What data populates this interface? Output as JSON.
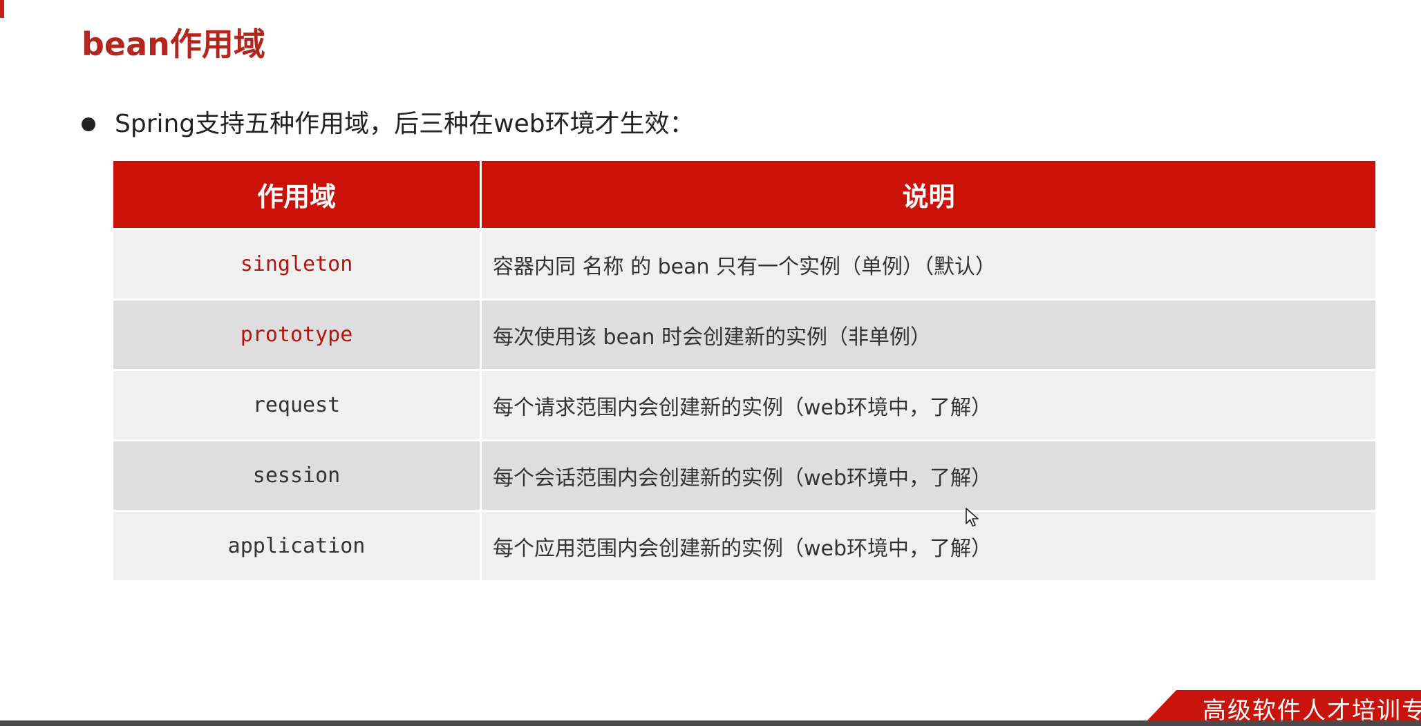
{
  "slide": {
    "title": "bean作用域",
    "bullet": "Spring支持五种作用域，后三种在web环境才生效：",
    "colors": {
      "accent": "#cc1208",
      "title": "#b3261e",
      "highlight_text": "#b3150c"
    }
  },
  "table": {
    "headers": {
      "scope": "作用域",
      "description": "说明"
    },
    "rows": [
      {
        "scope": "singleton",
        "description": "容器内同 名称 的 bean 只有一个实例（单例）（默认）",
        "highlight": true
      },
      {
        "scope": "prototype",
        "description": "每次使用该 bean 时会创建新的实例（非单例）",
        "highlight": true
      },
      {
        "scope": "request",
        "description": "每个请求范围内会创建新的实例（web环境中，了解）",
        "highlight": false
      },
      {
        "scope": "session",
        "description": "每个会话范围内会创建新的实例（web环境中，了解）",
        "highlight": false
      },
      {
        "scope": "application",
        "description": "每个应用范围内会创建新的实例（web环境中，了解）",
        "highlight": false
      }
    ]
  },
  "footer": {
    "banner_text": "高级软件人才培训专",
    "icons": [
      "bullet-dot-icon",
      "mouse-cursor-icon"
    ]
  }
}
